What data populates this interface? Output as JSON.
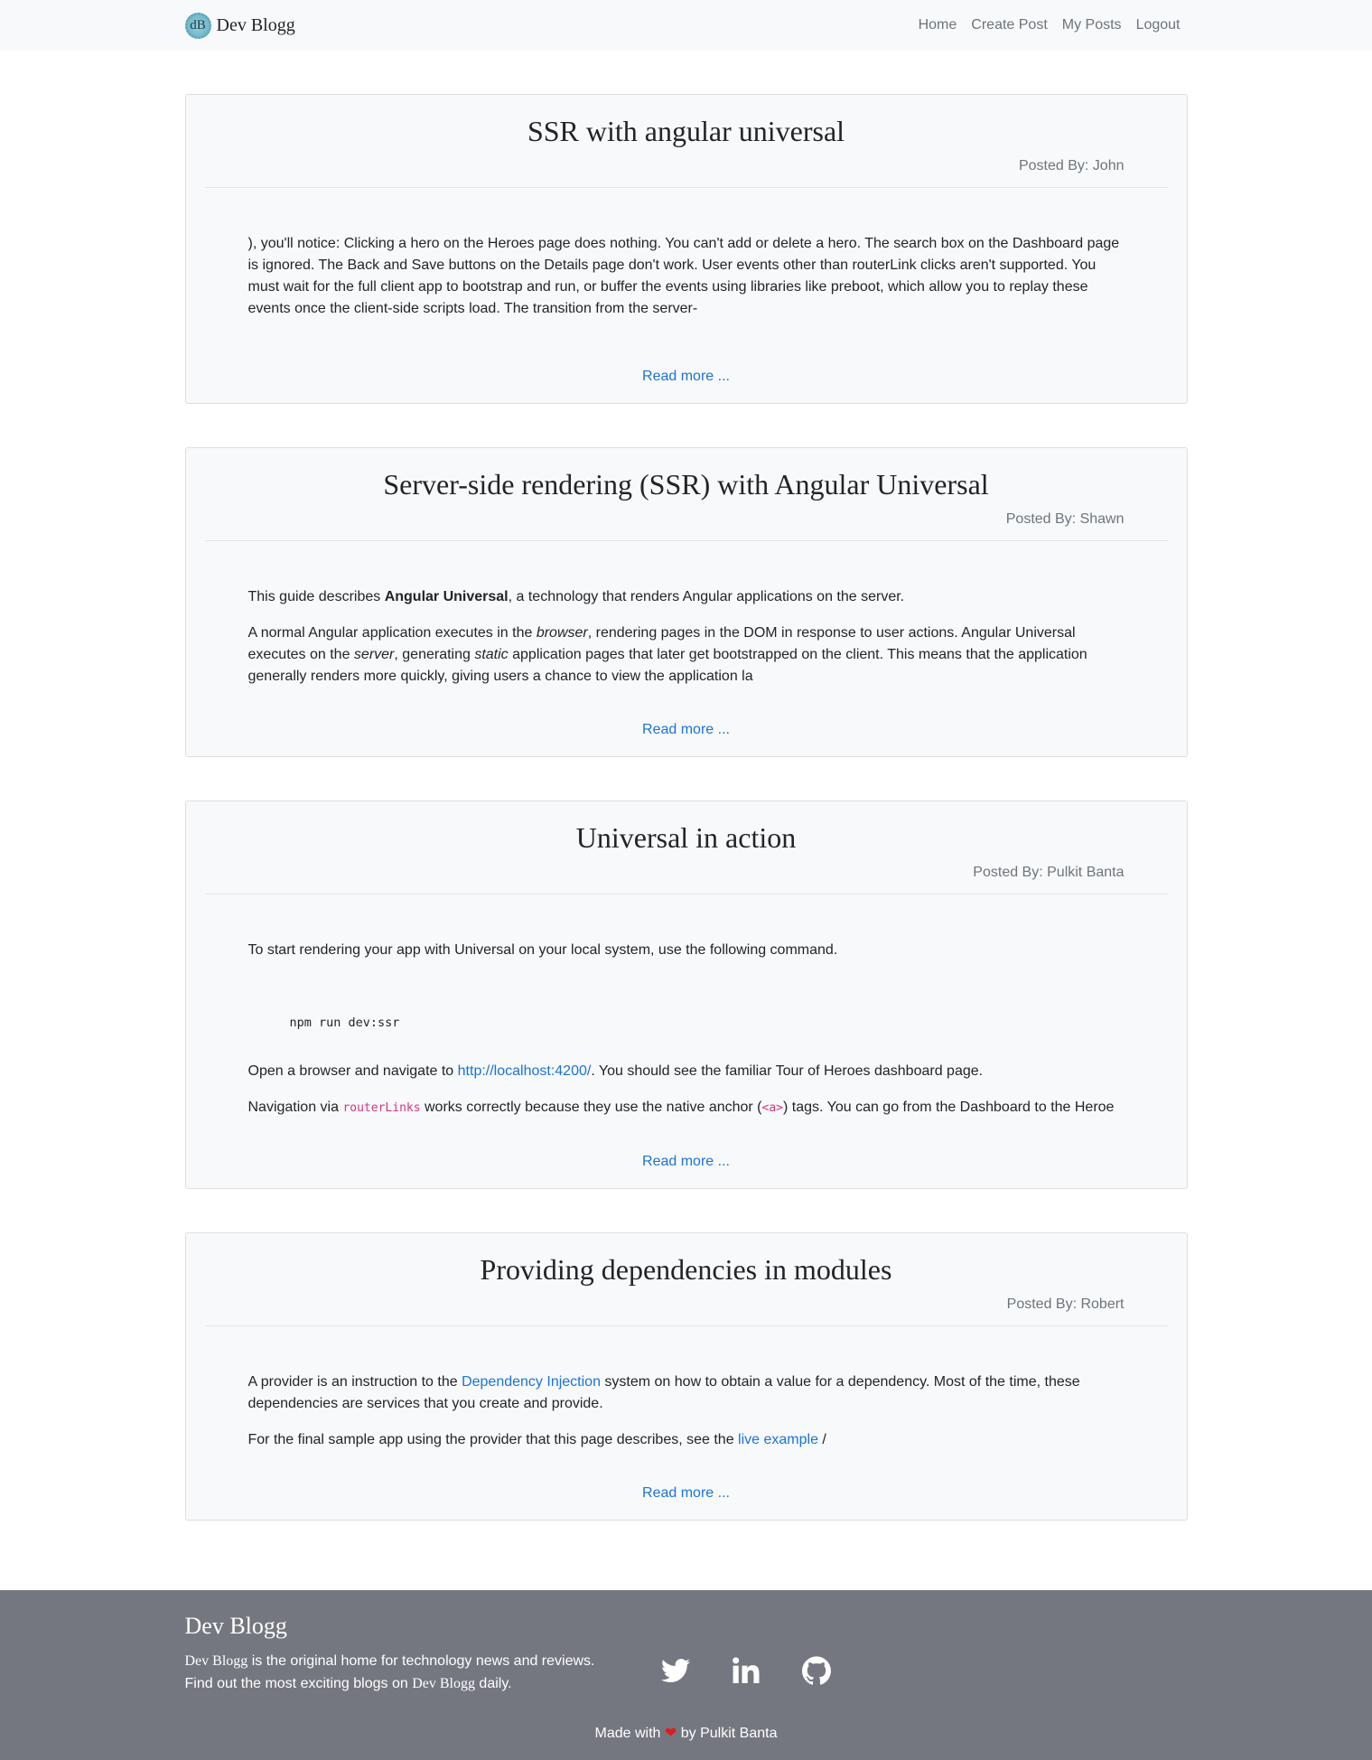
{
  "navbar": {
    "logo_text": "dB",
    "brand": "Dev Blogg",
    "links": [
      "Home",
      "Create Post",
      "My Posts",
      "Logout"
    ]
  },
  "posts": [
    {
      "title": "SSR with angular universal",
      "posted_by": "Posted By: John",
      "paragraphs": [
        "), you'll notice: Clicking a hero on the Heroes page does nothing. You can't add or delete a hero. The search box on the Dashboard page is ignored. The Back and Save buttons on the Details page don't work. User events other than routerLink clicks aren't supported. You must wait for the full client app to bootstrap and run, or buffer the events using libraries like preboot, which allow you to replay these events once the client-side scripts load. The transition from the server-"
      ],
      "read_more": "Read more ..."
    },
    {
      "title": "Server-side rendering (SSR) with Angular Universal",
      "posted_by": "Posted By: Shawn",
      "p1_pre": "This guide describes ",
      "p1_bold": "Angular Universal",
      "p1_post": ", a technology that renders Angular applications on the server.",
      "p2_a": "A normal Angular application executes in the ",
      "p2_em1": "browser",
      "p2_b": ", rendering pages in the DOM in response to user actions. Angular Universal executes on the ",
      "p2_em2": "server",
      "p2_c": ", generating ",
      "p2_em3": "static",
      "p2_d": " application pages that later get bootstrapped on the client. This means that the application generally renders more quickly, giving users a chance to view the application la",
      "read_more": "Read more ..."
    },
    {
      "title": "Universal in action",
      "posted_by": "Posted By: Pulkit Banta",
      "p1": "To start rendering your app with Universal on your local system, use the following command.",
      "code": "npm run dev:ssr",
      "p2_pre": "Open a browser and navigate to ",
      "p2_link": "http://localhost:4200/",
      "p2_post": ". You should see the familiar Tour of Heroes dashboard page.",
      "p3_a": "Navigation via ",
      "p3_code1": "routerLinks",
      "p3_b": " works correctly because they use the native anchor (",
      "p3_code2": "<a>",
      "p3_c": ") tags. You can go from the Dashboard to the Heroe",
      "read_more": "Read more ..."
    },
    {
      "title": "Providing dependencies in modules",
      "posted_by": "Posted By: Robert",
      "p1_pre": "A provider is an instruction to the ",
      "p1_link": "Dependency Injection",
      "p1_post": " system on how to obtain a value for a dependency. Most of the time, these dependencies are services that you create and provide.",
      "p2_pre": "For the final sample app using the provider that this page describes, see the ",
      "p2_link": "live example",
      "p2_post": " /",
      "read_more": "Read more ..."
    }
  ],
  "footer": {
    "title": "Dev Blogg",
    "desc1_brand": "Dev Blogg",
    "desc1_rest": " is the original home for technology news and reviews.",
    "desc2_pre": "Find out the most exciting blogs on ",
    "desc2_brand": "Dev Blogg",
    "desc2_post": " daily.",
    "social_icons": [
      "twitter-icon",
      "linkedin-icon",
      "github-icon"
    ],
    "made_pre": "Made with ",
    "made_post": " by Pulkit Banta"
  },
  "colors": {
    "navbar_bg": "#f8f9fa",
    "card_bg": "#f8f9fa",
    "link": "#1a73d9",
    "footer_bg": "#74777f",
    "heart": "#e01b1b"
  }
}
